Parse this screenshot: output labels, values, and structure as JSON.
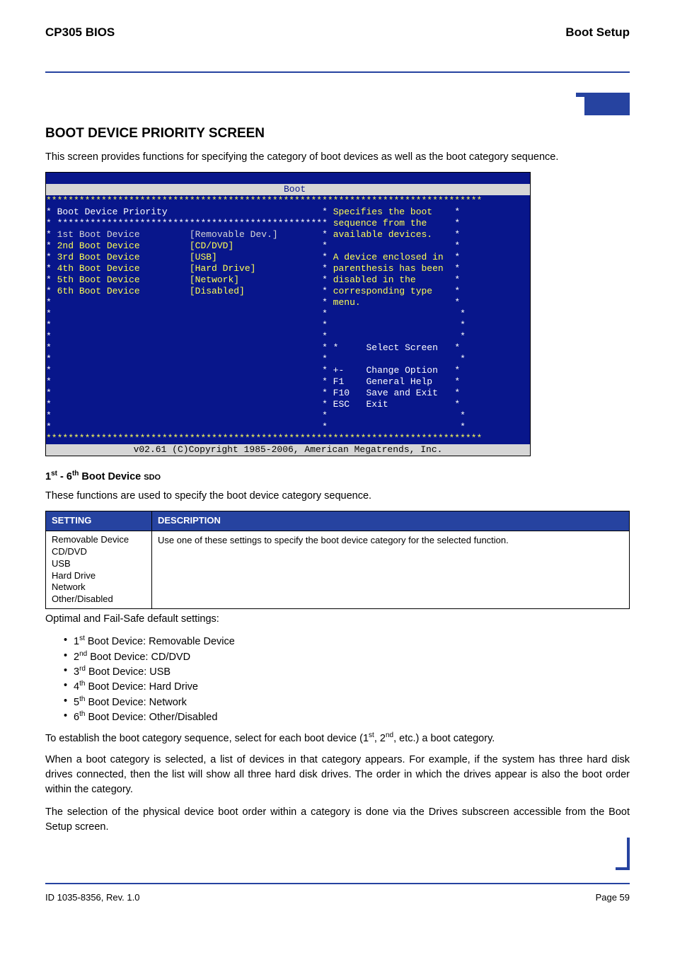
{
  "header": {
    "left": "CP305 BIOS",
    "right": "Boot Setup"
  },
  "section_title": "BOOT DEVICE PRIORITY SCREEN",
  "intro": "This screen provides functions for specifying the category of boot devices as well as the boot category sequence.",
  "bios": {
    "tab": "Boot",
    "title_line": "Boot Device Priority",
    "rows": [
      {
        "label": "1st Boot Device",
        "value": "[Removable Dev.]"
      },
      {
        "label": "2nd Boot Device",
        "value": "[CD/DVD]"
      },
      {
        "label": "3rd Boot Device",
        "value": "[USB]"
      },
      {
        "label": "4th Boot Device",
        "value": "[Hard Drive]"
      },
      {
        "label": "5th Boot Device",
        "value": "[Network]"
      },
      {
        "label": "6th Boot Device",
        "value": "[Disabled]"
      }
    ],
    "help": [
      "Specifies the boot",
      "sequence from the",
      "available devices.",
      "",
      "A device enclosed in",
      "parenthesis has been",
      "disabled in the",
      "corresponding type",
      "menu."
    ],
    "keys": [
      {
        "k": "*",
        "d": "Select Screen"
      },
      {
        "k": "+-",
        "d": "Change Option"
      },
      {
        "k": "F1",
        "d": "General Help"
      },
      {
        "k": "F10",
        "d": "Save and Exit"
      },
      {
        "k": "ESC",
        "d": "Exit"
      }
    ],
    "footer": "v02.61 (C)Copyright 1985-2006, American Megatrends, Inc."
  },
  "setting_heading": {
    "pre": "1",
    "pre_sup": "st",
    "mid": " - 6",
    "mid_sup": "th",
    "post": " Boot Device ",
    "tag": "SDO"
  },
  "setting_desc": "These functions are used to specify the boot device category sequence.",
  "table": {
    "head_setting": "SETTING",
    "head_desc": "DESCRIPTION",
    "options": [
      "Removable Device",
      "CD/DVD",
      "USB",
      "Hard Drive",
      "Network",
      "Other/Disabled"
    ],
    "desc": "Use one of these settings to specify the boot device category for the selected function."
  },
  "optimal_intro": "Optimal and Fail-Safe default settings:",
  "defaults": [
    {
      "n": "1",
      "sup": "st",
      "label": " Boot Device:  Removable Device"
    },
    {
      "n": "2",
      "sup": "nd",
      "label": " Boot Device: CD/DVD"
    },
    {
      "n": "3",
      "sup": "rd",
      "label": " Boot Device:  USB"
    },
    {
      "n": "4",
      "sup": "th",
      "label": " Boot Device:  Hard Drive"
    },
    {
      "n": "5",
      "sup": "th",
      "label": " Boot Device:  Network"
    },
    {
      "n": "6",
      "sup": "th",
      "label": " Boot Device:  Other/Disabled"
    }
  ],
  "p_establish": {
    "a": "To establish the boot category sequence, select for each boot device (1",
    "b": ", 2",
    "c": ", etc.) a boot category."
  },
  "p_when": "When a boot category is selected, a list of devices in that category appears. For example, if the system has three hard disk drives connected, then the list will show all three hard disk drives. The order in which the drives appear is also the boot order within the category.",
  "p_selection": "The selection of the physical device boot order within a category is done via the Drives subscreen accessible from the Boot Setup screen.",
  "footer": {
    "left": "ID 1035-8356, Rev. 1.0",
    "right": "Page 59"
  }
}
